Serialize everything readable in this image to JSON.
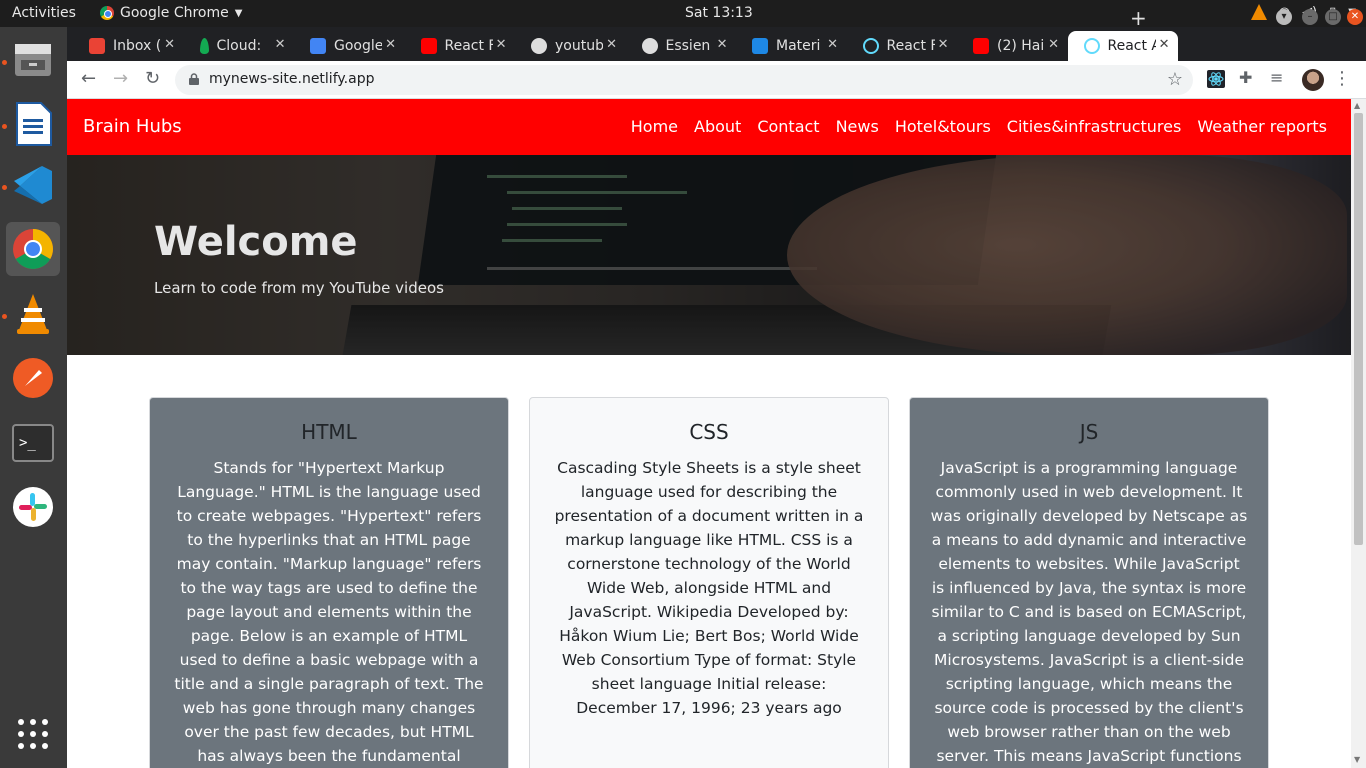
{
  "os": {
    "activities": "Activities",
    "app_menu": "Google Chrome",
    "clock": "Sat 13:13"
  },
  "browser": {
    "tabs": [
      {
        "title": "Inbox (",
        "favicon": "gmail-icon",
        "color": "#ea4335"
      },
      {
        "title": "Cloud:",
        "favicon": "mongodb-leaf-icon",
        "color": "#13aa52"
      },
      {
        "title": "Google",
        "favicon": "google-maps-icon",
        "color": "#4285f4"
      },
      {
        "title": "React F",
        "favicon": "youtube-icon",
        "color": "#ff0000"
      },
      {
        "title": "youtub",
        "favicon": "github-icon",
        "color": "#dddddd"
      },
      {
        "title": "Essien",
        "favicon": "github-icon",
        "color": "#dddddd"
      },
      {
        "title": "Materi",
        "favicon": "material-ui-icon",
        "color": "#1e88e5"
      },
      {
        "title": "React F",
        "favicon": "react-icon",
        "color": "#61dafb"
      },
      {
        "title": "(2) Hai",
        "favicon": "youtube-icon",
        "color": "#ff0000"
      },
      {
        "title": "React A",
        "favicon": "react-icon",
        "color": "#61dafb"
      }
    ],
    "url": "mynews-site.netlify.app"
  },
  "site": {
    "brand": "Brain Hubs",
    "nav": [
      "Home",
      "About",
      "Contact",
      "News",
      "Hotel&tours",
      "Cities&infrastructures",
      "Weather reports"
    ],
    "hero_title": "Welcome",
    "hero_subtitle": "Learn to code from my YouTube videos",
    "cards": [
      {
        "title": "HTML",
        "text": "Stands for \"Hypertext Markup Language.\" HTML is the language used to create webpages. \"Hypertext\" refers to the hyperlinks that an HTML page may contain. \"Markup language\" refers to the way tags are used to define the page layout and elements within the page. Below is an example of HTML used to define a basic webpage with a title and a single paragraph of text. The web has gone through many changes over the past few decades, but HTML has always been the fundamental language used to develop webpages."
      },
      {
        "title": "CSS",
        "text": "Cascading Style Sheets is a style sheet language used for describing the presentation of a document written in a markup language like HTML. CSS is a cornerstone technology of the World Wide Web, alongside HTML and JavaScript. Wikipedia Developed by: Håkon Wium Lie; Bert Bos; World Wide Web Consortium Type of format: Style sheet language Initial release: December 17, 1996; 23 years ago"
      },
      {
        "title": "JS",
        "text": "JavaScript is a programming language commonly used in web development. It was originally developed by Netscape as a means to add dynamic and interactive elements to websites. While JavaScript is influenced by Java, the syntax is more similar to C and is based on ECMAScript, a scripting language developed by Sun Microsystems. JavaScript is a client-side scripting language, which means the source code is processed by the client's web browser rather than on the web server. This means JavaScript functions can run after a"
      }
    ],
    "colors": {
      "navbar": "#ff0000",
      "card_dark": "#6c757d",
      "card_light": "#f8f9fa"
    }
  }
}
